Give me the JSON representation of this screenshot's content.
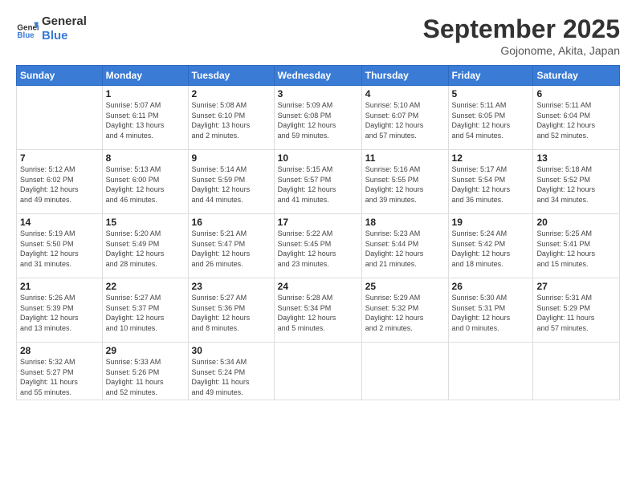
{
  "header": {
    "logo_line1": "General",
    "logo_line2": "Blue",
    "month": "September 2025",
    "location": "Gojonome, Akita, Japan"
  },
  "weekdays": [
    "Sunday",
    "Monday",
    "Tuesday",
    "Wednesday",
    "Thursday",
    "Friday",
    "Saturday"
  ],
  "weeks": [
    [
      {
        "day": "",
        "info": ""
      },
      {
        "day": "1",
        "info": "Sunrise: 5:07 AM\nSunset: 6:11 PM\nDaylight: 13 hours\nand 4 minutes."
      },
      {
        "day": "2",
        "info": "Sunrise: 5:08 AM\nSunset: 6:10 PM\nDaylight: 13 hours\nand 2 minutes."
      },
      {
        "day": "3",
        "info": "Sunrise: 5:09 AM\nSunset: 6:08 PM\nDaylight: 12 hours\nand 59 minutes."
      },
      {
        "day": "4",
        "info": "Sunrise: 5:10 AM\nSunset: 6:07 PM\nDaylight: 12 hours\nand 57 minutes."
      },
      {
        "day": "5",
        "info": "Sunrise: 5:11 AM\nSunset: 6:05 PM\nDaylight: 12 hours\nand 54 minutes."
      },
      {
        "day": "6",
        "info": "Sunrise: 5:11 AM\nSunset: 6:04 PM\nDaylight: 12 hours\nand 52 minutes."
      }
    ],
    [
      {
        "day": "7",
        "info": "Sunrise: 5:12 AM\nSunset: 6:02 PM\nDaylight: 12 hours\nand 49 minutes."
      },
      {
        "day": "8",
        "info": "Sunrise: 5:13 AM\nSunset: 6:00 PM\nDaylight: 12 hours\nand 46 minutes."
      },
      {
        "day": "9",
        "info": "Sunrise: 5:14 AM\nSunset: 5:59 PM\nDaylight: 12 hours\nand 44 minutes."
      },
      {
        "day": "10",
        "info": "Sunrise: 5:15 AM\nSunset: 5:57 PM\nDaylight: 12 hours\nand 41 minutes."
      },
      {
        "day": "11",
        "info": "Sunrise: 5:16 AM\nSunset: 5:55 PM\nDaylight: 12 hours\nand 39 minutes."
      },
      {
        "day": "12",
        "info": "Sunrise: 5:17 AM\nSunset: 5:54 PM\nDaylight: 12 hours\nand 36 minutes."
      },
      {
        "day": "13",
        "info": "Sunrise: 5:18 AM\nSunset: 5:52 PM\nDaylight: 12 hours\nand 34 minutes."
      }
    ],
    [
      {
        "day": "14",
        "info": "Sunrise: 5:19 AM\nSunset: 5:50 PM\nDaylight: 12 hours\nand 31 minutes."
      },
      {
        "day": "15",
        "info": "Sunrise: 5:20 AM\nSunset: 5:49 PM\nDaylight: 12 hours\nand 28 minutes."
      },
      {
        "day": "16",
        "info": "Sunrise: 5:21 AM\nSunset: 5:47 PM\nDaylight: 12 hours\nand 26 minutes."
      },
      {
        "day": "17",
        "info": "Sunrise: 5:22 AM\nSunset: 5:45 PM\nDaylight: 12 hours\nand 23 minutes."
      },
      {
        "day": "18",
        "info": "Sunrise: 5:23 AM\nSunset: 5:44 PM\nDaylight: 12 hours\nand 21 minutes."
      },
      {
        "day": "19",
        "info": "Sunrise: 5:24 AM\nSunset: 5:42 PM\nDaylight: 12 hours\nand 18 minutes."
      },
      {
        "day": "20",
        "info": "Sunrise: 5:25 AM\nSunset: 5:41 PM\nDaylight: 12 hours\nand 15 minutes."
      }
    ],
    [
      {
        "day": "21",
        "info": "Sunrise: 5:26 AM\nSunset: 5:39 PM\nDaylight: 12 hours\nand 13 minutes."
      },
      {
        "day": "22",
        "info": "Sunrise: 5:27 AM\nSunset: 5:37 PM\nDaylight: 12 hours\nand 10 minutes."
      },
      {
        "day": "23",
        "info": "Sunrise: 5:27 AM\nSunset: 5:36 PM\nDaylight: 12 hours\nand 8 minutes."
      },
      {
        "day": "24",
        "info": "Sunrise: 5:28 AM\nSunset: 5:34 PM\nDaylight: 12 hours\nand 5 minutes."
      },
      {
        "day": "25",
        "info": "Sunrise: 5:29 AM\nSunset: 5:32 PM\nDaylight: 12 hours\nand 2 minutes."
      },
      {
        "day": "26",
        "info": "Sunrise: 5:30 AM\nSunset: 5:31 PM\nDaylight: 12 hours\nand 0 minutes."
      },
      {
        "day": "27",
        "info": "Sunrise: 5:31 AM\nSunset: 5:29 PM\nDaylight: 11 hours\nand 57 minutes."
      }
    ],
    [
      {
        "day": "28",
        "info": "Sunrise: 5:32 AM\nSunset: 5:27 PM\nDaylight: 11 hours\nand 55 minutes."
      },
      {
        "day": "29",
        "info": "Sunrise: 5:33 AM\nSunset: 5:26 PM\nDaylight: 11 hours\nand 52 minutes."
      },
      {
        "day": "30",
        "info": "Sunrise: 5:34 AM\nSunset: 5:24 PM\nDaylight: 11 hours\nand 49 minutes."
      },
      {
        "day": "",
        "info": ""
      },
      {
        "day": "",
        "info": ""
      },
      {
        "day": "",
        "info": ""
      },
      {
        "day": "",
        "info": ""
      }
    ]
  ]
}
